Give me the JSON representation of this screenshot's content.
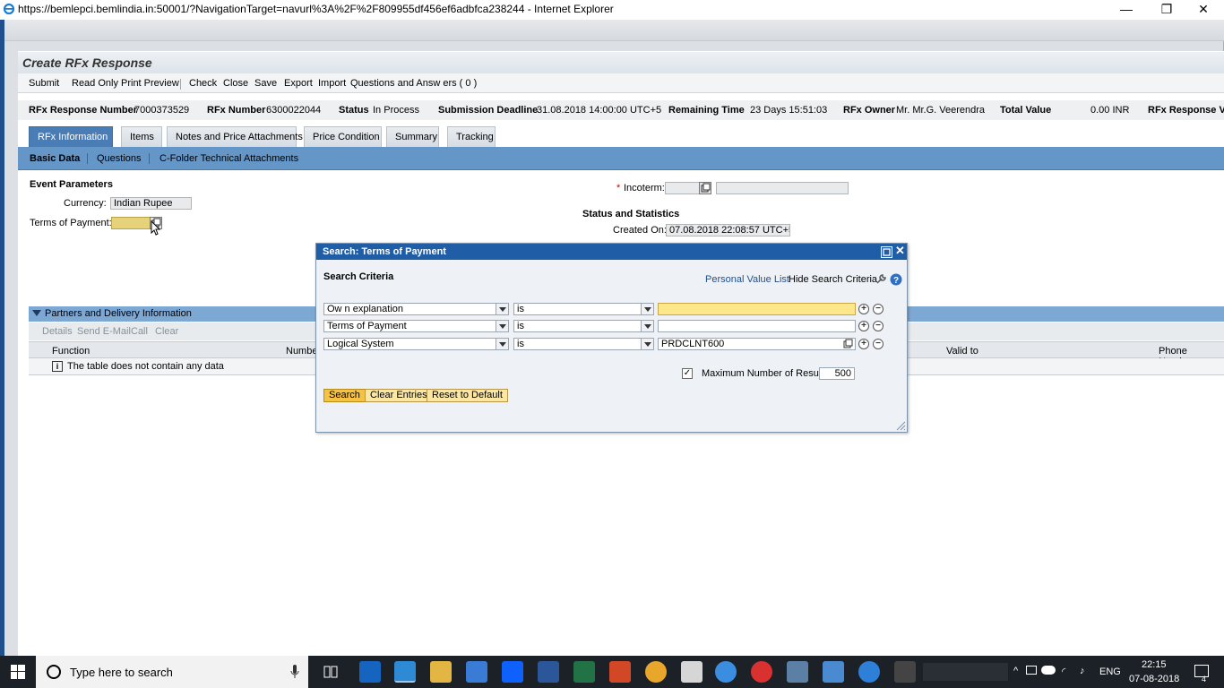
{
  "window": {
    "title": "https://bemlepci.bemlindia.in:50001/?NavigationTarget=navurl%3A%2F%2F809955df456ef6adbfca238244 - Internet Explorer",
    "minimize": "—",
    "restore": "❐",
    "close": "✕"
  },
  "page": {
    "title": "Create RFx Response"
  },
  "toolbar": {
    "submit": "Submit",
    "read_only": "Read Only",
    "print_preview": "Print Preview",
    "check": "Check",
    "close": "Close",
    "save": "Save",
    "export": "Export",
    "import": "Import",
    "qa": "Questions and Answ ers ( 0 )"
  },
  "info": {
    "response_number_label": "RFx Response Number",
    "response_number": "7000373529",
    "rfx_number_label": "RFx Number",
    "rfx_number": "6300022044",
    "status_label": "Status",
    "status": "In Process",
    "deadline_label": "Submission Deadline",
    "deadline": "31.08.2018 14:00:00 UTC+5",
    "remaining_label": "Remaining Time",
    "remaining": "23 Days 15:51:03",
    "owner_label": "RFx Owner",
    "owner": "Mr. Mr.G. Veerendra",
    "total_label": "Total Value",
    "total": "0.00 INR",
    "response_ver_label": "RFx Response Ve"
  },
  "tabs": [
    {
      "label": "RFx Information",
      "active": true
    },
    {
      "label": "Items"
    },
    {
      "label": "Notes and Price Attachments"
    },
    {
      "label": "Price Condition"
    },
    {
      "label": "Summary"
    },
    {
      "label": "Tracking"
    }
  ],
  "subtabs": [
    {
      "label": "Basic Data",
      "active": true
    },
    {
      "label": "Questions"
    },
    {
      "label": "C-Folder Technical Attachments"
    }
  ],
  "event": {
    "header": "Event Parameters",
    "currency_label": "Currency:",
    "currency_value": "Indian Rupee",
    "terms_label": "Terms of Payment:"
  },
  "incoterm": {
    "required": "*",
    "label": "Incoterm:"
  },
  "status_stats": {
    "header": "Status and Statistics",
    "created_label": "Created On:",
    "created_value": "07.08.2018 22:08:57 UTC+5"
  },
  "partners": {
    "header": "Partners and Delivery Information",
    "toolbar": [
      "Details",
      "Send E-Mail",
      "Call",
      "Clear"
    ],
    "columns": {
      "function": "Function",
      "number": "Number",
      "valid_to": "Valid to",
      "phone": "Phone Number"
    },
    "empty": "The table does not contain any data"
  },
  "dialog": {
    "title": "Search: Terms of Payment",
    "criteria_header": "Search Criteria",
    "personal_value_list": "Personal Value List",
    "hide_criteria": "Hide Search Criteria",
    "rows": [
      {
        "field": "Ow n explanation",
        "operator": "is",
        "value": ""
      },
      {
        "field": "Terms of Payment",
        "operator": "is",
        "value": ""
      },
      {
        "field": "Logical System",
        "operator": "is",
        "value": "PRDCLNT600"
      }
    ],
    "max_results_label": "Maximum Number of Results:",
    "max_results_value": "500",
    "max_results_checked": true,
    "buttons": {
      "search": "Search",
      "clear": "Clear Entries",
      "reset": "Reset to Default"
    }
  },
  "taskbar": {
    "search_placeholder": "Type here to search",
    "lang": "ENG",
    "time": "22:15",
    "date": "07-08-2018",
    "notifications": "4"
  },
  "colors": {
    "accent": "#1f5ea7",
    "tab_active": "#4a7db6",
    "subtab_bar": "#6596c8",
    "highlight_field": "#fce88a",
    "button_primary": "#f5c243"
  }
}
